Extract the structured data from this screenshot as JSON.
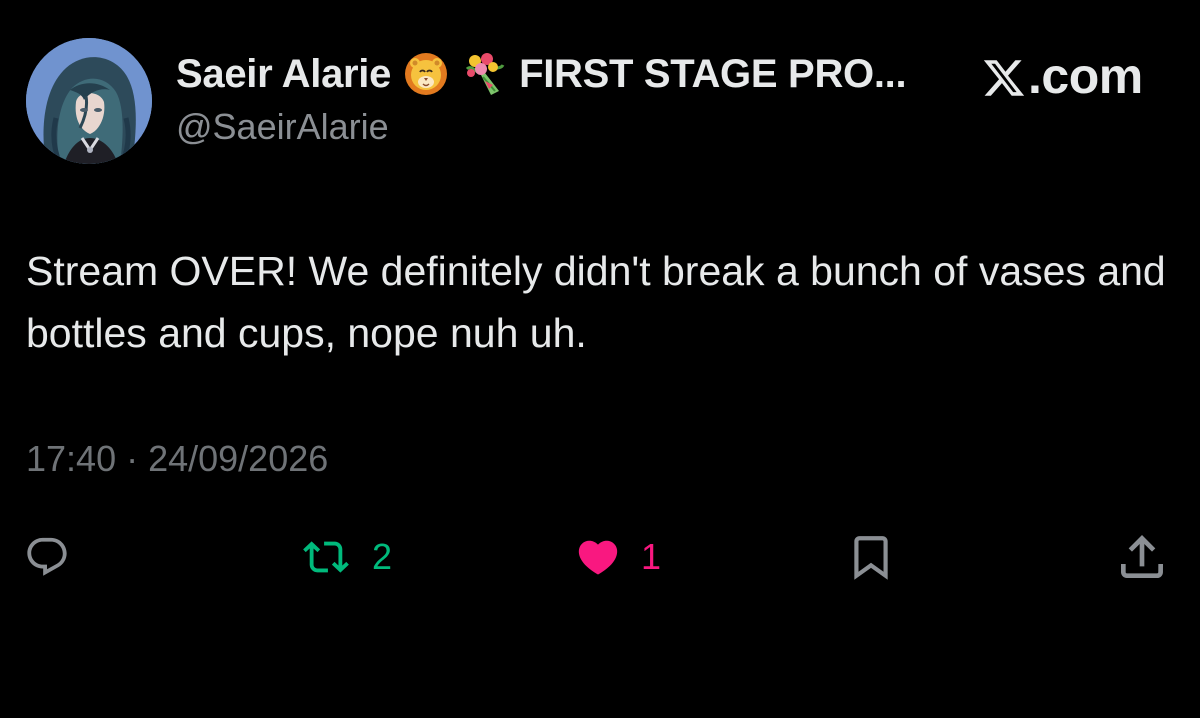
{
  "author": {
    "display_name": "Saeir Alarie",
    "name_suffix": "FIRST STAGE PRO...",
    "handle": "@SaeirAlarie",
    "emojis": [
      "lion-face-emoji",
      "bouquet-emoji"
    ]
  },
  "source": {
    "label": ".com",
    "logo": "x-logo-icon"
  },
  "tweet": {
    "text": "Stream OVER! We definitely didn't break a bunch of vases and bottles and cups, nope nuh uh.",
    "timestamp": "17:40 · 24/09/2026"
  },
  "actions": {
    "reply": {
      "icon": "reply-icon"
    },
    "repost": {
      "icon": "repost-icon",
      "count": "2",
      "color": "#00ba7c"
    },
    "like": {
      "icon": "heart-icon",
      "count": "1",
      "color": "#f91880"
    },
    "bookmark": {
      "icon": "bookmark-icon"
    },
    "share": {
      "icon": "share-icon"
    }
  },
  "colors": {
    "background": "#000000",
    "text_primary": "#e7e9ea",
    "text_secondary": "#8b8f94",
    "icon_default": "#8b8f94"
  }
}
